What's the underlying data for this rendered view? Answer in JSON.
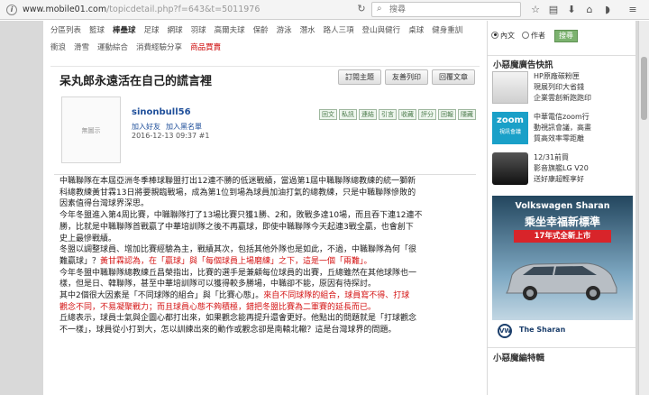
{
  "browser": {
    "url_host": "www.mobile01.com",
    "url_path": "/topicdetail.php?f=643&t=5011976",
    "search_placeholder": "搜尋"
  },
  "categories": {
    "row1": [
      "分區列表",
      "籃球",
      "棒壘球",
      "足球",
      "網球",
      "羽球",
      "高爾夫球",
      "保齡",
      "游泳",
      "潛水",
      "路人三項",
      "登山與健行",
      "桌球",
      "健身重訓"
    ],
    "row2": [
      "衝浪",
      "滑雪",
      "運動綜合",
      "消費經驗分享",
      "商品買賣"
    ]
  },
  "topic": {
    "title": "呆丸郎永遠活在自己的謊言裡",
    "buttons": [
      "訂閱主題",
      "友善列印",
      "回覆文章"
    ]
  },
  "post": {
    "avatar_text": "無圖示",
    "username": "sinonbull56",
    "user_links": [
      "加入好友",
      "加入黑名單"
    ],
    "date": "2016-12-13 09:37",
    "floor": "#1",
    "actions": [
      "回文",
      "私訊",
      "連結",
      "引言",
      "收藏",
      "評分",
      "回報",
      "隱藏"
    ]
  },
  "content": {
    "lines": [
      [
        {
          "t": "中職聯隊在本屆亞洲冬季棒球聯盟打出12連不勝的低迷戰績，當過第1屆中職聯隊總教練的統一獅新"
        }
      ],
      [
        {
          "t": "科總教練黃甘霖13日將要親臨戰場，成為第1位到場為球員加油打氣的總教練，只是中職聯隊慘敗的"
        }
      ],
      [
        {
          "t": "因素值得台灣球界深思。"
        }
      ],
      [
        {
          "t": "今年冬盟進入第4周比賽，中職聯隊打了13場比賽只獲1勝、2和，敗戰多達10場，而且吞下連12連不"
        }
      ],
      [
        {
          "t": "勝，比就是中職聯隊首戰贏了中華培訓隊之後不再贏球，即使中職聯隊今天起連3戰全贏，也會創下"
        }
      ],
      [
        {
          "t": "史上最慘戰績。"
        }
      ],
      [
        {
          "t": "冬盟以調整球員、增加比賽經驗為主，戰績其次，包括其他外隊也是如此，不過，中職聯隊為何「很"
        }
      ],
      [
        {
          "t": "難贏球」？"
        },
        {
          "t": "黃甘霖認為，在「贏球」與「每個球員上場磨練」之下，這是一個「兩難」。",
          "red": true
        }
      ],
      [
        {
          "t": "今年冬盟中職聯隊總教練丘昌榮指出，比賽的選手是兼顧每位球員的出賽，丘總雖然在其他球隊也一"
        }
      ],
      [
        {
          "t": "樣，但是日、韓聯隊，甚至中華培訓隊可以獲得較多勝場，中職卻不能，原因有待探討。"
        }
      ],
      [
        {
          "t": "其中2個很大因素是「不同球隊的組合」與「比賽心態」。"
        },
        {
          "t": "來自不同球隊的組合，球員寫不得、打球",
          "red": true
        }
      ],
      [
        {
          "t": "觀念不同，不易凝聚戰力；而且球員心態不夠積極，錯把冬盟比賽為二軍賽的延長而已。",
          "red": true
        }
      ],
      [
        {
          "t": "丘總表示，球員士氣與企圖心都打出來，如果觀念能再提升還會更好。他點出的問題就是「打球觀念"
        }
      ],
      [
        {
          "t": "不一樣」，球員從小打到大，怎以訓練出來的動作或觀念卻是南轅北轍？這是台灣球界的問題。"
        }
      ]
    ]
  },
  "sidebar": {
    "radio_options": [
      "內文",
      "作者"
    ],
    "search_button": "搜尋",
    "ads_heading": "小惡魔廣告快訊",
    "news": [
      [
        "HP原廠碳粉匣",
        "現展列印大省錢",
        "企業雲創新跑跑印"
      ],
      [
        "中華電信zoom行",
        "動視訊會議，高畫",
        "質高效率零距離"
      ],
      [
        "12/31前買",
        "影音旗艦LG V20",
        "送好康超輕享好"
      ]
    ],
    "zoom_brand": "zoom",
    "zoom_sub": "視訊會議",
    "ad_banner": {
      "brand_line": "Volkswagen Sharan",
      "headline": "乘坐幸福新標準",
      "promo": "17年式全新上市",
      "logo": "VW",
      "model": "The Sharan"
    },
    "editor_heading": "小惡魔編特輯"
  },
  "colors": {
    "link": "#1f4f9a",
    "highlight_red": "#d41313",
    "search_button": "#7cb26f"
  }
}
